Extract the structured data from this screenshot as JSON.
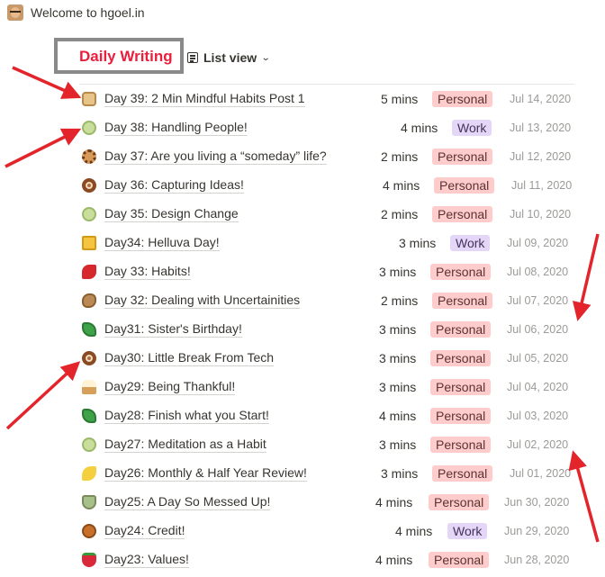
{
  "site": {
    "title": "Welcome to hgoel.in",
    "avatar_icon": "avatar-photo"
  },
  "database": {
    "title": "Daily Writing",
    "title_color": "#eb1e3b",
    "view_label": "List view",
    "view_icon": "list-view-icon"
  },
  "tag_colors": {
    "Personal": "#ffcccc",
    "Work": "#e4d6f6"
  },
  "annotation_color": "#e3242b",
  "rows": [
    {
      "icon": "bread-icon",
      "title": "Day 39: 2 Min Mindful Habits Post 1",
      "mins": "5 mins",
      "tag": "Personal",
      "date": "Jul 14, 2020"
    },
    {
      "icon": "melon-icon",
      "title": "Day 38: Handling People!",
      "mins": "4 mins",
      "tag": "Work",
      "date": "Jul 13, 2020"
    },
    {
      "icon": "cookie-icon",
      "title": "Day 37: Are you living a “someday” life?",
      "mins": "2 mins",
      "tag": "Personal",
      "date": "Jul 12, 2020"
    },
    {
      "icon": "doughnut-icon",
      "title": "Day 36: Capturing Ideas!",
      "mins": "4 mins",
      "tag": "Personal",
      "date": "Jul 11, 2020"
    },
    {
      "icon": "melon-icon",
      "title": "Day 35: Design Change",
      "mins": "2 mins",
      "tag": "Personal",
      "date": "Jul 10, 2020"
    },
    {
      "icon": "cheese-icon",
      "title": "Day34: Helluva Day!",
      "mins": "3 mins",
      "tag": "Work",
      "date": "Jul 09, 2020"
    },
    {
      "icon": "chili-icon",
      "title": "Day 33: Habits!",
      "mins": "3 mins",
      "tag": "Personal",
      "date": "Jul 08, 2020"
    },
    {
      "icon": "potato-icon",
      "title": "Day 32: Dealing with Uncertainities",
      "mins": "2 mins",
      "tag": "Personal",
      "date": "Jul 07, 2020"
    },
    {
      "icon": "lettuce-icon",
      "title": "Day31: Sister's Birthday!",
      "mins": "3 mins",
      "tag": "Personal",
      "date": "Jul 06, 2020"
    },
    {
      "icon": "doughnut-icon",
      "title": "Day30: Little Break From Tech",
      "mins": "3 mins",
      "tag": "Personal",
      "date": "Jul 05, 2020"
    },
    {
      "icon": "ice-cream-icon",
      "title": "Day29: Being Thankful!",
      "mins": "3 mins",
      "tag": "Personal",
      "date": "Jul 04, 2020"
    },
    {
      "icon": "lettuce-icon",
      "title": "Day28: Finish what you Start!",
      "mins": "4 mins",
      "tag": "Personal",
      "date": "Jul 03, 2020"
    },
    {
      "icon": "melon-icon",
      "title": "Day27: Meditation as a Habit",
      "mins": "3 mins",
      "tag": "Personal",
      "date": "Jul 02, 2020"
    },
    {
      "icon": "banana-icon",
      "title": "Day26: Monthly & Half Year Review!",
      "mins": "3 mins",
      "tag": "Personal",
      "date": "Jul 01, 2020"
    },
    {
      "icon": "tea-cup-icon",
      "title": "Day25: A Day So Messed Up!",
      "mins": "4 mins",
      "tag": "Personal",
      "date": "Jun 30, 2020"
    },
    {
      "icon": "pie-icon",
      "title": "Day24: Credit!",
      "mins": "4 mins",
      "tag": "Work",
      "date": "Jun 29, 2020"
    },
    {
      "icon": "strawberry-icon",
      "title": "Day23: Values!",
      "mins": "4 mins",
      "tag": "Personal",
      "date": "Jun 28, 2020"
    }
  ]
}
